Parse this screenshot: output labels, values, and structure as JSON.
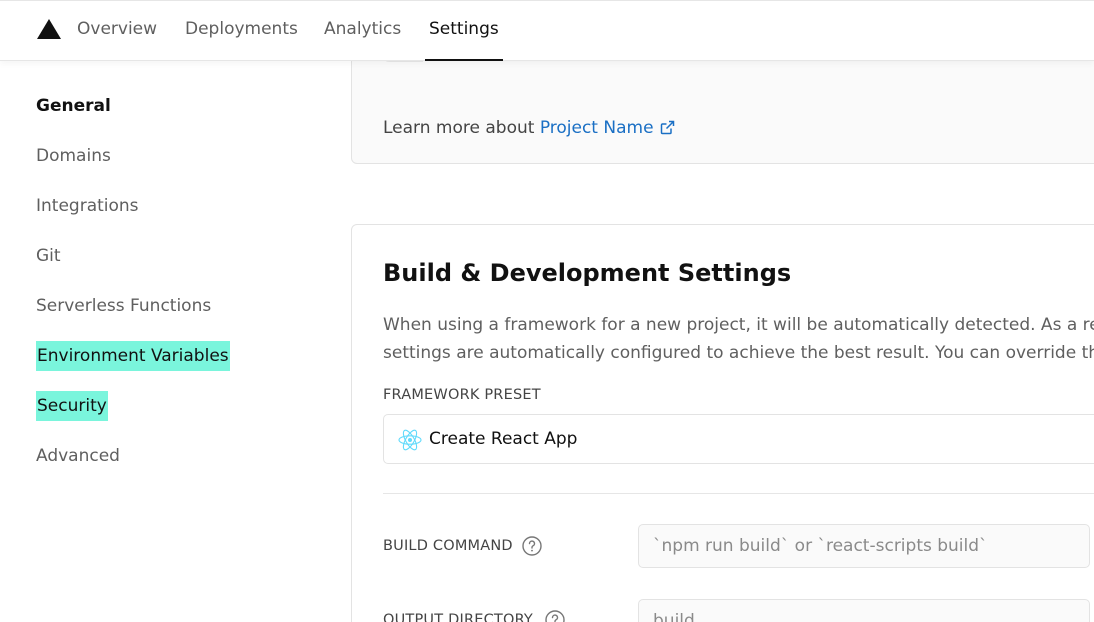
{
  "nav": {
    "logo_icon": "triangle-logo-icon",
    "tabs": [
      {
        "label": "Overview"
      },
      {
        "label": "Deployments"
      },
      {
        "label": "Analytics"
      },
      {
        "label": "Settings",
        "active": true
      }
    ]
  },
  "sidebar": {
    "items": [
      {
        "label": "General",
        "active": true
      },
      {
        "label": "Domains"
      },
      {
        "label": "Integrations"
      },
      {
        "label": "Git"
      },
      {
        "label": "Serverless Functions"
      },
      {
        "label": "Environment Variables",
        "highlighted": true
      },
      {
        "label": "Security",
        "highlighted": true
      },
      {
        "label": "Advanced"
      }
    ],
    "highlight_color": "#7af5dc"
  },
  "project_name_card": {
    "learn_prefix": "Learn more about",
    "learn_link": "Project Name",
    "link_icon": "external-link-icon",
    "link_color": "#1a6fc4"
  },
  "build_settings": {
    "title": "Build & Development Settings",
    "description_line1": "When using a framework for a new project, it will be automatically detected. As a result, several project",
    "description_line2": "settings are automatically configured to achieve the best result. You can override them below.",
    "framework_label": "FRAMEWORK PRESET",
    "framework_icon": "react-icon",
    "framework_value": "Create React App",
    "build_command_label": "BUILD COMMAND",
    "build_command_placeholder": "`npm run build` or `react-scripts build`",
    "output_directory_label": "OUTPUT DIRECTORY",
    "output_directory_placeholder": "build",
    "help_icon": "question-mark-icon"
  }
}
